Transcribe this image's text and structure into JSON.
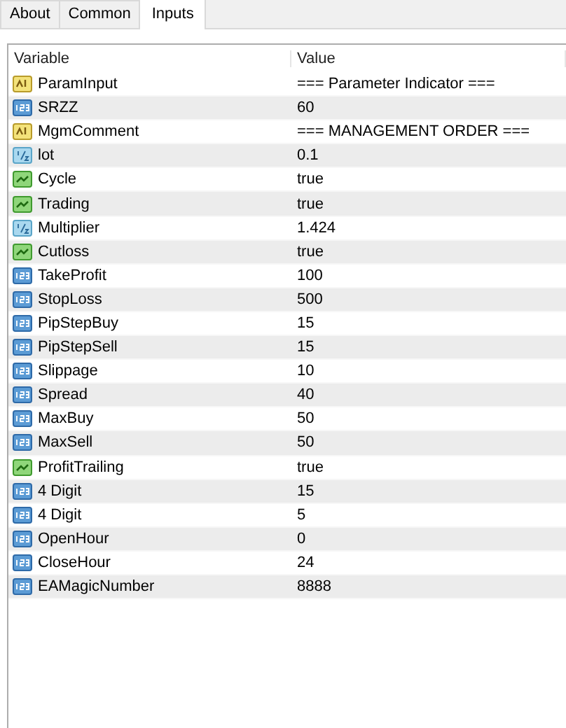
{
  "tabs": [
    {
      "label": "About",
      "selected": false
    },
    {
      "label": "Common",
      "selected": false
    },
    {
      "label": "Inputs",
      "selected": true
    }
  ],
  "table": {
    "columns": [
      "Variable",
      "Value"
    ],
    "rows": [
      {
        "kind": "string",
        "variable": "ParamInput",
        "value": "=== Parameter Indicator ==="
      },
      {
        "kind": "int",
        "variable": "SRZZ",
        "value": "60"
      },
      {
        "kind": "string",
        "variable": "MgmComment",
        "value": "=== MANAGEMENT ORDER ==="
      },
      {
        "kind": "double",
        "variable": "lot",
        "value": "0.1"
      },
      {
        "kind": "bool",
        "variable": "Cycle",
        "value": "true"
      },
      {
        "kind": "bool",
        "variable": "Trading",
        "value": "true"
      },
      {
        "kind": "double",
        "variable": "Multiplier",
        "value": "1.424"
      },
      {
        "kind": "bool",
        "variable": "Cutloss",
        "value": "true"
      },
      {
        "kind": "int",
        "variable": "TakeProfit",
        "value": "100"
      },
      {
        "kind": "int",
        "variable": "StopLoss",
        "value": "500"
      },
      {
        "kind": "int",
        "variable": "PipStepBuy",
        "value": "15"
      },
      {
        "kind": "int",
        "variable": "PipStepSell",
        "value": "15"
      },
      {
        "kind": "int",
        "variable": "Slippage",
        "value": "10"
      },
      {
        "kind": "int",
        "variable": "Spread",
        "value": "40"
      },
      {
        "kind": "int",
        "variable": "MaxBuy",
        "value": "50"
      },
      {
        "kind": "int",
        "variable": "MaxSell",
        "value": "50"
      },
      {
        "kind": "bool",
        "variable": "ProfitTrailing",
        "value": "true"
      },
      {
        "kind": "int",
        "variable": "4 Digit",
        "value": "15"
      },
      {
        "kind": "int",
        "variable": "4 Digit",
        "value": "5"
      },
      {
        "kind": "int",
        "variable": "OpenHour",
        "value": "0"
      },
      {
        "kind": "int",
        "variable": "CloseHour",
        "value": "24"
      },
      {
        "kind": "int",
        "variable": "EAMagicNumber",
        "value": "8888"
      }
    ]
  }
}
